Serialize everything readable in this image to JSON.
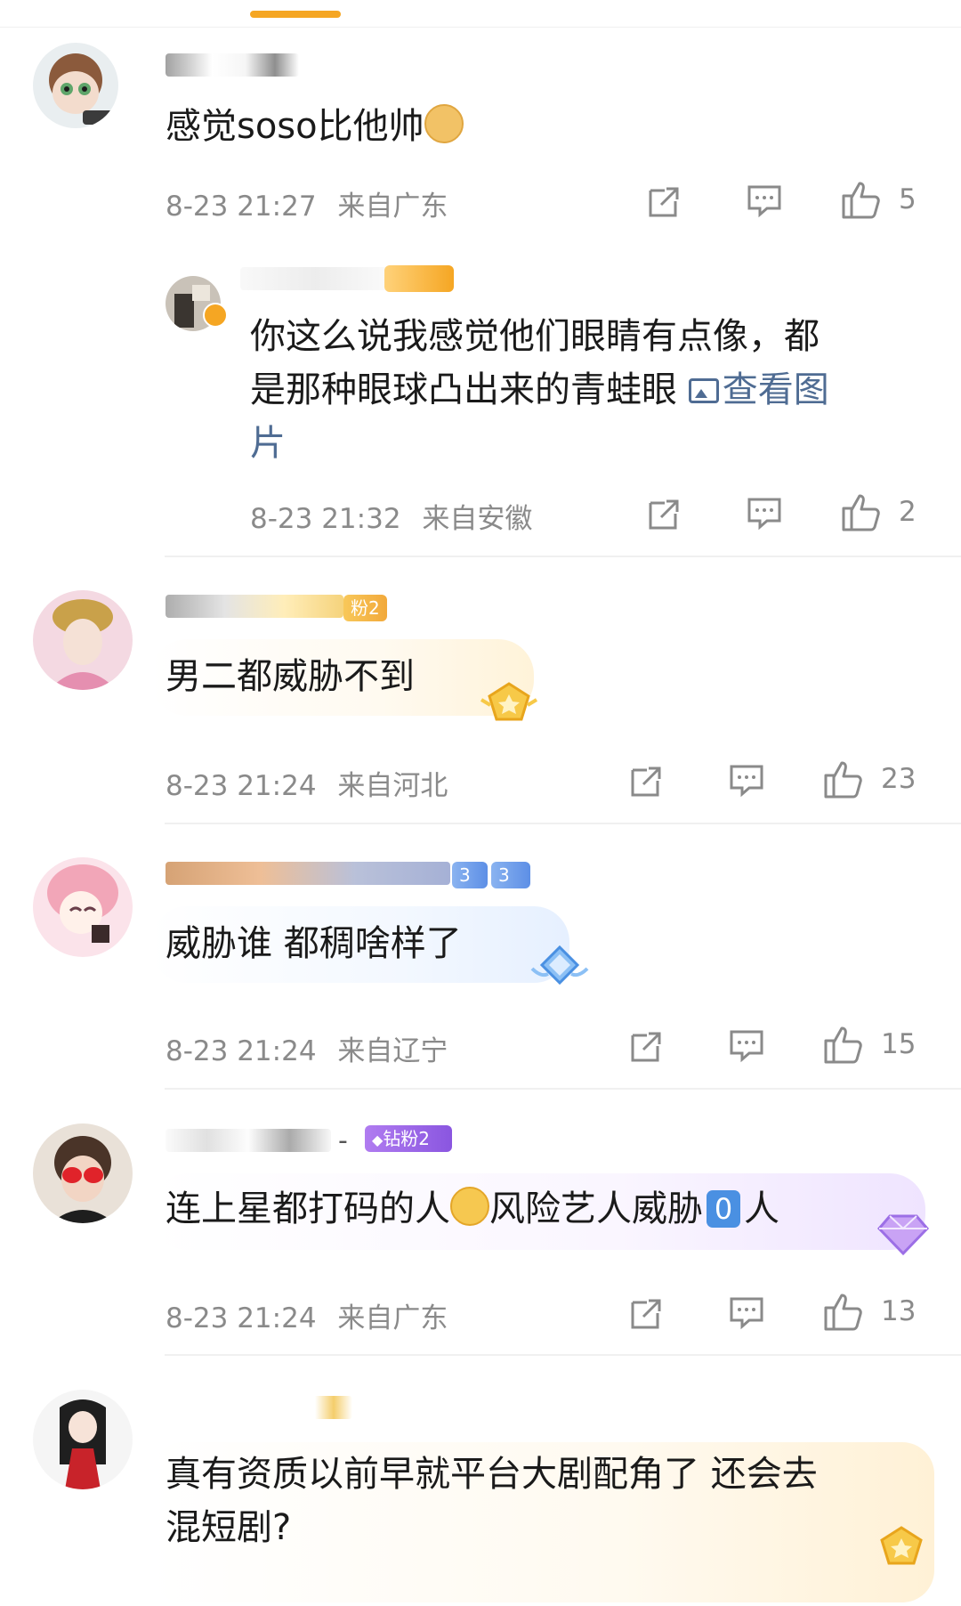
{
  "header": {
    "indicator_color": "#f5a623"
  },
  "comments": [
    {
      "text": "感觉soso比他帅",
      "time": "8-23 21:27",
      "location": "来自广东",
      "likes": "5",
      "emoji": "doge-emoji",
      "reply": {
        "text_line1": "你这么说我感觉他们眼睛有点像，都",
        "text_line2": "是那种眼球凸出来的青蛙眼",
        "link_line2": "查看图",
        "link_line3": "片",
        "time": "8-23 21:32",
        "location": "来自安徽",
        "likes": "2"
      }
    },
    {
      "text": "男二都威胁不到",
      "time": "8-23 21:24",
      "location": "来自河北",
      "likes": "23",
      "badge": "粉2"
    },
    {
      "text": "威胁谁 都稠啥样了",
      "time": "8-23 21:24",
      "location": "来自辽宁",
      "likes": "15",
      "badge": "3"
    },
    {
      "text_before": "连上星都打码的人",
      "text_middle": "风险艺人威胁",
      "boxed": "0",
      "text_after": "人",
      "time": "8-23 21:24",
      "location": "来自广东",
      "likes": "13",
      "badge": "钻粉2",
      "name_suffix": "-"
    },
    {
      "text_line1": "真有资质以前早就平台大剧配角了 还会去",
      "text_line2": "混短剧?"
    }
  ],
  "colors": {
    "meta_gray": "#8a8a8a",
    "link_blue": "#4f6c93",
    "accent": "#f5a623"
  }
}
